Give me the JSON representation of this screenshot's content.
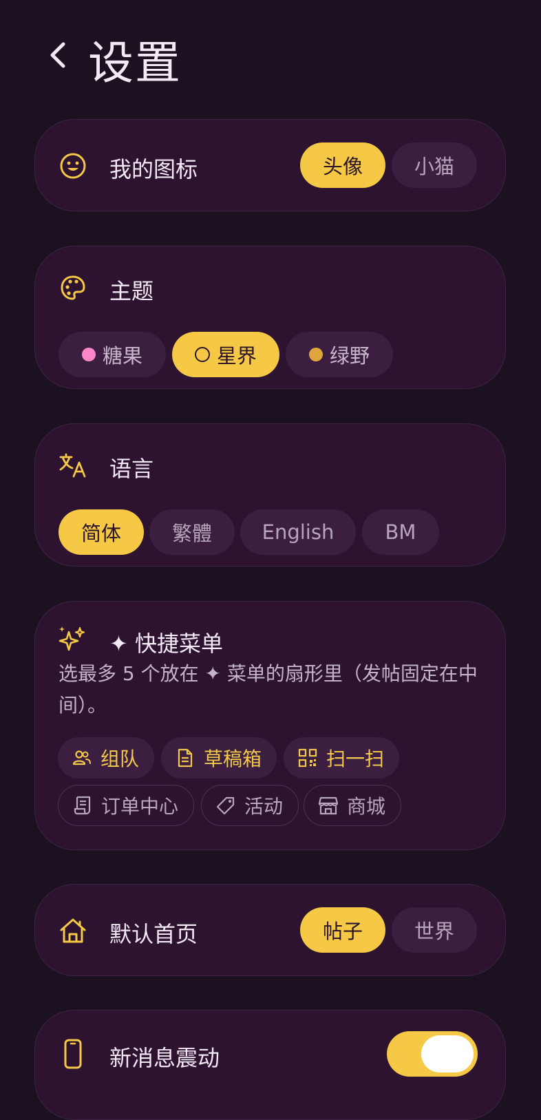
{
  "header": {
    "title": "设置"
  },
  "icon_setting": {
    "label": "我的图标",
    "options": [
      "头像",
      "小猫"
    ],
    "selected": 0
  },
  "theme": {
    "label": "主题",
    "options": [
      {
        "label": "糖果",
        "dot_color": "#ff86c8"
      },
      {
        "label": "星界",
        "dot_color": ""
      },
      {
        "label": "绿野",
        "dot_color": "#e0a63d"
      }
    ],
    "selected": 1
  },
  "language": {
    "label": "语言",
    "options": [
      "简体",
      "繁體",
      "English",
      "BM"
    ],
    "selected": 0
  },
  "quick_menu": {
    "label": "✦ 快捷菜单",
    "description": "选最多 5 个放在 ✦ 菜单的扇形里（发帖固定在中间）。",
    "items": [
      {
        "label": "组队",
        "icon": "people-icon",
        "selected": true
      },
      {
        "label": "草稿箱",
        "icon": "document-icon",
        "selected": true
      },
      {
        "label": "扫一扫",
        "icon": "qr-code-icon",
        "selected": true
      },
      {
        "label": "订单中心",
        "icon": "receipt-icon",
        "selected": false
      },
      {
        "label": "活动",
        "icon": "tag-icon",
        "selected": false
      },
      {
        "label": "商城",
        "icon": "store-icon",
        "selected": false
      }
    ]
  },
  "default_home": {
    "label": "默认首页",
    "options": [
      "帖子",
      "世界"
    ],
    "selected": 0
  },
  "vibrate": {
    "label": "新消息震动",
    "enabled": true
  },
  "colors": {
    "accent": "#f5c945",
    "card": "#2d1330",
    "background": "#1b1121"
  }
}
